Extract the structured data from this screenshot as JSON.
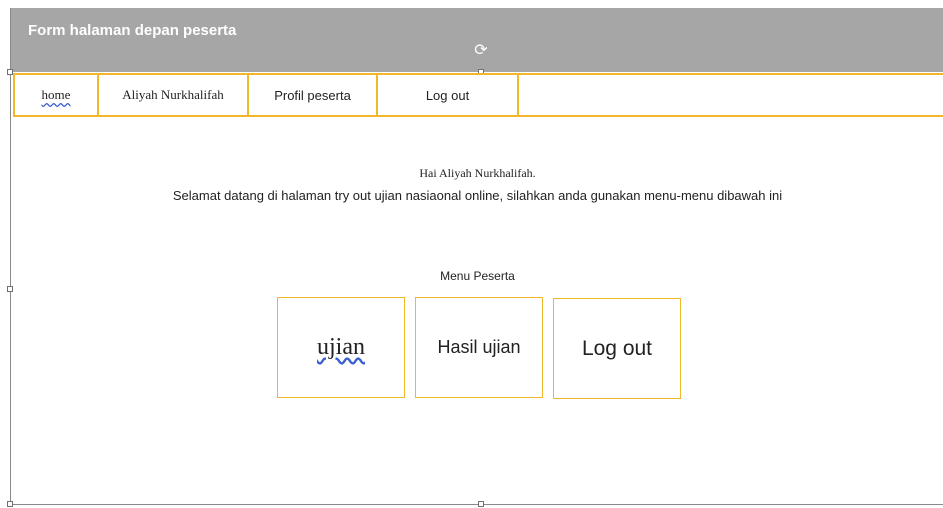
{
  "window": {
    "title": "Form halaman depan peserta"
  },
  "nav": {
    "items": [
      {
        "label": "home"
      },
      {
        "label": "Aliyah Nurkhalifah"
      },
      {
        "label": "Profil peserta"
      },
      {
        "label": "Log out"
      }
    ]
  },
  "main": {
    "greeting": "Hai Aliyah Nurkhalifah.",
    "welcome": "Selamat datang di halaman try out ujian nasiaonal online, silahkan anda gunakan menu-menu dibawah ini",
    "menu_title": "Menu Peserta",
    "menu": [
      {
        "label": "ujian"
      },
      {
        "label": "Hasil ujian"
      },
      {
        "label": "Log out"
      }
    ]
  },
  "colors": {
    "titlebar": "#a6a6a6",
    "accent_border": "#f1b82c"
  },
  "icons": {
    "rotate": "rotate-handle-icon"
  }
}
